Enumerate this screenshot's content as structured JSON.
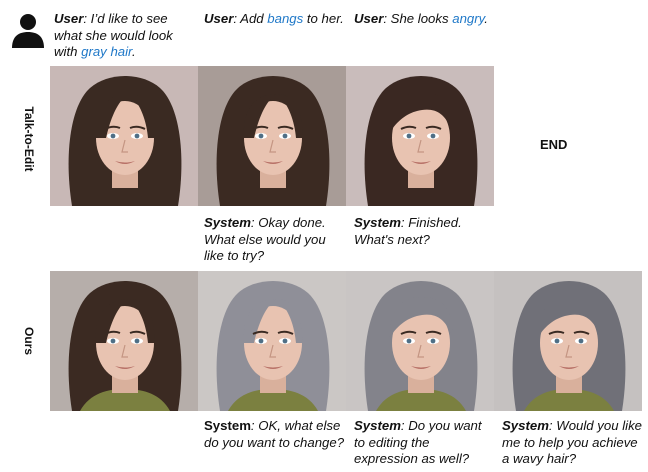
{
  "prompts": [
    {
      "speaker": "User",
      "pre": ": I’d like to see what she would look with ",
      "highlight": "gray hair",
      "post": "."
    },
    {
      "speaker": "User",
      "pre": ": Add ",
      "highlight": "bangs",
      "post": " to her."
    },
    {
      "speaker": "User",
      "pre": ": She looks ",
      "highlight": "angry",
      "post": "."
    }
  ],
  "row_labels": {
    "talk_to_edit": "Talk-to-Edit",
    "ours": "Ours"
  },
  "end_label": "END",
  "talk_to_edit_responses": [
    {
      "speaker": "System",
      "text": ": Okay done. What else would you like to try?"
    },
    {
      "speaker": "System",
      "text": ": Finished. What's next?"
    }
  ],
  "ours_responses": [
    {
      "speaker": "System",
      "text": ": OK, what else do you want to change?"
    },
    {
      "speaker": "System",
      "text": ": Do you want to editing the expression as well?"
    },
    {
      "speaker": "System",
      "text": ": Would you like me to help you achieve a wavy hair?"
    }
  ],
  "icons": {
    "user": "user-silhouette-icon"
  },
  "colors": {
    "highlight": "#1f78c8"
  }
}
